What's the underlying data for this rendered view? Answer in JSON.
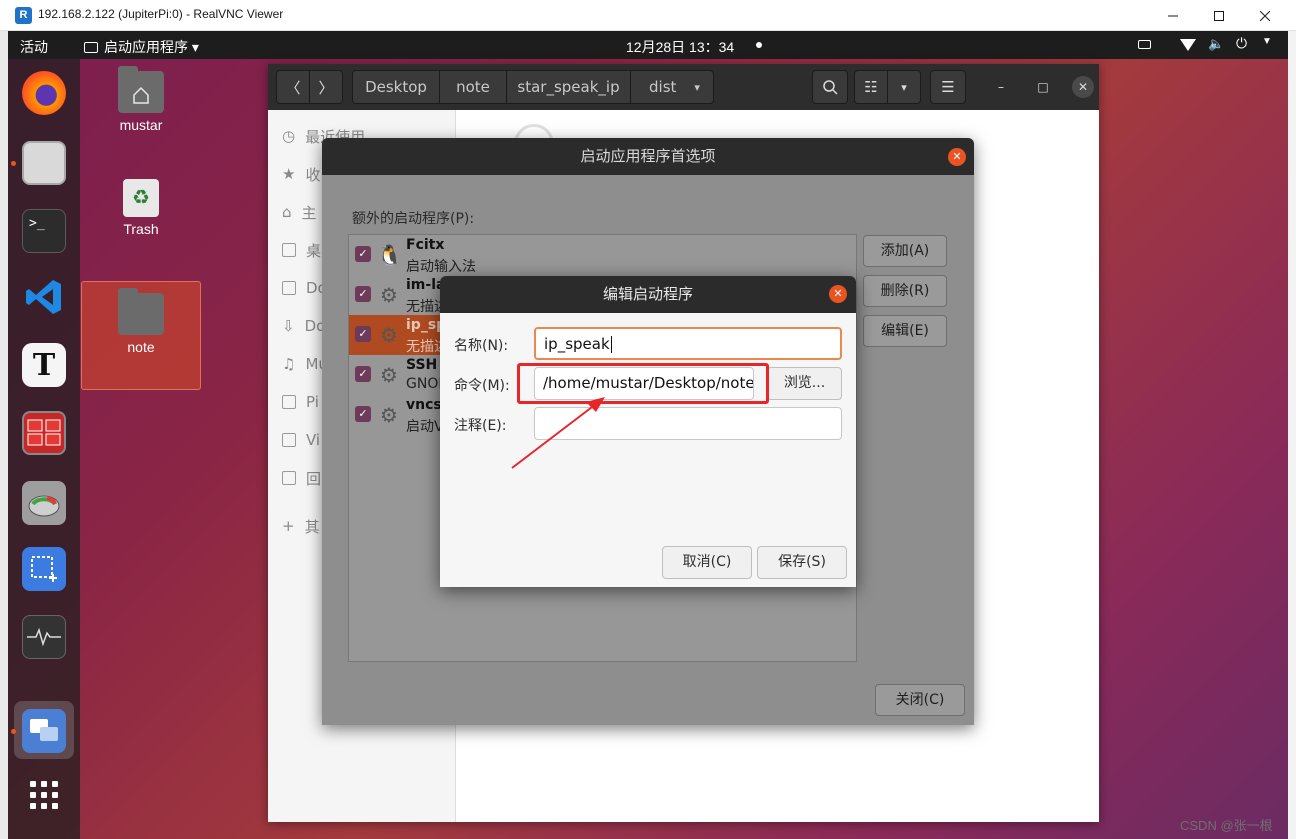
{
  "vnc": {
    "title": "192.168.2.122 (JupiterPi:0) - RealVNC Viewer",
    "app_icon_text": "R"
  },
  "topbar": {
    "activities": "活动",
    "app_menu": "启动应用程序 ▾",
    "clock": "12月28日  13：34"
  },
  "desktop_icons": [
    {
      "label": "mustar",
      "icon": "home-folder-icon"
    },
    {
      "label": "Trash",
      "icon": "trash-icon"
    },
    {
      "label": "note",
      "icon": "folder-icon"
    }
  ],
  "dock": [
    {
      "name": "firefox",
      "icon": "firefox-icon"
    },
    {
      "name": "files",
      "icon": "files-icon"
    },
    {
      "name": "terminal",
      "icon": "terminal-icon",
      "glyph": ">_"
    },
    {
      "name": "vscode",
      "icon": "vscode-icon"
    },
    {
      "name": "typora",
      "icon": "typora-icon",
      "glyph": "T"
    },
    {
      "name": "remmina",
      "icon": "remote-desktop-icon"
    },
    {
      "name": "disk-usage",
      "icon": "disk-usage-icon"
    },
    {
      "name": "screenshot",
      "icon": "screenshot-icon"
    },
    {
      "name": "system-monitor",
      "icon": "system-monitor-icon"
    },
    {
      "name": "vnc",
      "icon": "vnc-icon"
    },
    {
      "name": "show-apps",
      "icon": "apps-grid-icon"
    }
  ],
  "files_window": {
    "nav_back": "〈",
    "nav_forward": "〉",
    "breadcrumbs": [
      "Desktop",
      "note",
      "star_speak_ip",
      "dist"
    ],
    "breadcrumb_arrow": "▾",
    "search_icon": "🔍",
    "view_icon": "☷",
    "view_arrow": "▾",
    "menu_icon": "☰",
    "win_min": "–",
    "win_max": "□",
    "win_close": "✕",
    "sidebar": [
      {
        "label": "最近使用",
        "icon": "recent-icon"
      },
      {
        "label": "收",
        "icon": "star-icon"
      },
      {
        "label": "主",
        "icon": "home-icon"
      },
      {
        "label": "桌",
        "icon": "desktop-icon"
      },
      {
        "label": "Do",
        "icon": "documents-icon"
      },
      {
        "label": "Do",
        "icon": "downloads-icon"
      },
      {
        "label": "Mu",
        "icon": "music-icon"
      },
      {
        "label": "Pi",
        "icon": "pictures-icon"
      },
      {
        "label": "Vi",
        "icon": "videos-icon"
      },
      {
        "label": "回",
        "icon": "trash-icon"
      },
      {
        "label": "其",
        "icon": "plus-icon"
      }
    ]
  },
  "prefs_dialog": {
    "title": "启动应用程序首选项",
    "list_label": "额外的启动程序(P):",
    "items": [
      {
        "name": "Fcitx",
        "desc": "启动输入法",
        "checked": true,
        "icon": "penguin-icon",
        "selected": false
      },
      {
        "name": "im-la",
        "desc": "无描述",
        "checked": true,
        "icon": "gears-icon",
        "selected": false
      },
      {
        "name": "ip_sp",
        "desc": "无描述",
        "checked": true,
        "icon": "gears-icon",
        "selected": true
      },
      {
        "name": "SSH",
        "desc": "GNOM",
        "checked": true,
        "icon": "gears-icon",
        "selected": false
      },
      {
        "name": "vncst",
        "desc": "启动V",
        "checked": true,
        "icon": "gears-icon",
        "selected": false
      }
    ],
    "add_button": "添加(A)",
    "remove_button": "删除(R)",
    "edit_button": "编辑(E)",
    "close_button": "关闭(C)"
  },
  "edit_dialog": {
    "title": "编辑启动程序",
    "name_label": "名称(N):",
    "name_value": "ip_speak",
    "command_label": "命令(M):",
    "command_value": "/home/mustar/Desktop/note/",
    "browse_button": "浏览...",
    "comment_label": "注释(E):",
    "comment_value": "",
    "cancel_button": "取消(C)",
    "save_button": "保存(S)"
  },
  "annotation": {
    "color": "#e8262a"
  },
  "watermark": "CSDN @张一根",
  "colors": {
    "accent": "#e95420",
    "topbar": "#1d1d1d",
    "dialog_title": "#2b2b2b"
  }
}
